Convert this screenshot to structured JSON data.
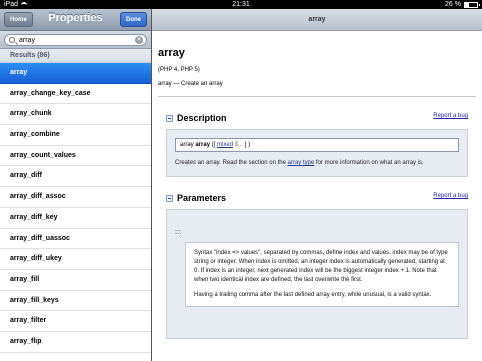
{
  "status": {
    "device": "iPad",
    "time": "21:31",
    "battery": "26 %"
  },
  "left": {
    "nav_title": "Properties",
    "home_button": "Home",
    "done_button": "Done",
    "search_value": "array",
    "results_header": "Results (86)",
    "results": [
      "array",
      "array_change_key_case",
      "array_chunk",
      "array_combine",
      "array_count_values",
      "array_diff",
      "array_diff_assoc",
      "array_diff_key",
      "array_diff_uassoc",
      "array_diff_ukey",
      "array_fill",
      "array_fill_keys",
      "array_filter",
      "array_flip"
    ]
  },
  "right": {
    "nav_title": "array",
    "fn_name": "array",
    "fn_version": "(PHP 4, PHP 5)",
    "fn_purpose": "array — Create an array",
    "description": {
      "title": "Description",
      "report": "Report a bug",
      "syntax_type": "array",
      "syntax_name": "array",
      "syntax_open": "([",
      "syntax_param_type": "mixed",
      "syntax_param_name": "$...",
      "syntax_close": "] )",
      "text_before": "Creates an array. Read the section on the",
      "text_link": "array type",
      "text_after": "for more information on what an array is."
    },
    "parameters": {
      "title": "Parameters",
      "report": "Report a bug",
      "dots": "...",
      "note_1": "Syntax \"index => values\", separated by commas, define index and values. index may be of type string or integer. When index is omitted, an integer index is automatically generated, starting at 0. If index is an integer, next generated index will be the biggest integer index + 1. Note that when two identical index are defined, the last overwrite the first.",
      "note_2": "Having a trailing comma after the last defined array entry, while unusual, is a valid syntax."
    }
  }
}
